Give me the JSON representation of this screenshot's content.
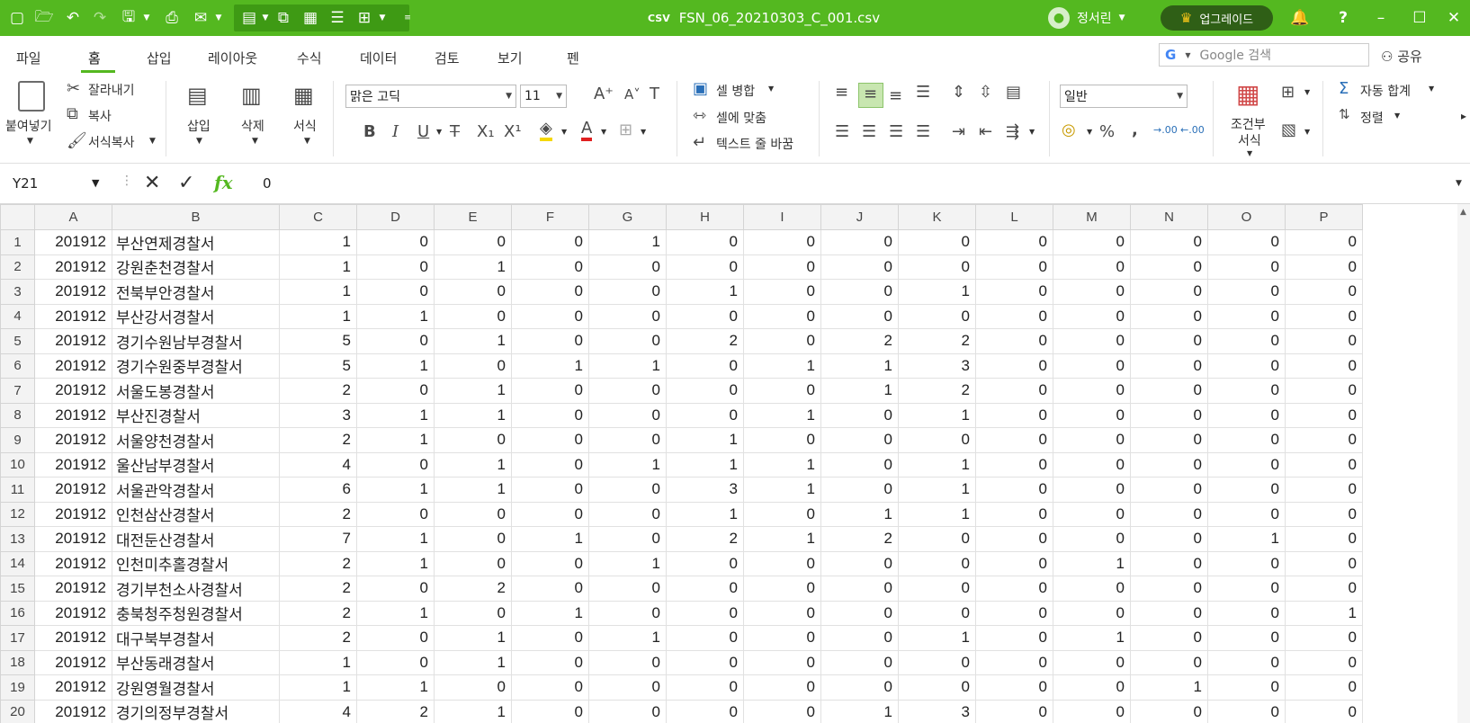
{
  "titlebar": {
    "file_badge": "CSV",
    "filename": "FSN_06_20210303_C_001.csv",
    "user_name": "정서린",
    "upgrade_label": "업그레이드",
    "icons": [
      "new-doc-icon",
      "open-folder-icon",
      "undo-icon",
      "redo-icon",
      "save-icon",
      "print-icon",
      "mail-icon",
      "paste-special-icon",
      "copy-format-icon",
      "form-icon",
      "list-icon",
      "table-icon",
      "more-icon",
      "bell-icon",
      "help-icon",
      "minimize-icon",
      "maximize-icon",
      "close-icon"
    ]
  },
  "menu": {
    "tabs": [
      "파일",
      "홈",
      "삽입",
      "레이아웃",
      "수식",
      "데이터",
      "검토",
      "보기",
      "펜"
    ],
    "active_tab": "홈",
    "search_placeholder": "Google 검색",
    "share_label": "공유"
  },
  "ribbon": {
    "paste": "붙여넣기",
    "cut": "잘라내기",
    "copy": "복사",
    "format_painter": "서식복사",
    "insert": "삽입",
    "delete": "삭제",
    "format": "서식",
    "font_name": "맑은 고딕",
    "font_size": "11",
    "merge": "셀 병합",
    "fit": "셀에 맞춤",
    "wrap": "텍스트 줄 바꿈",
    "number_format": "일반",
    "percent": "%",
    "comma": ",",
    "cond_format_1": "조건부",
    "cond_format_2": "서식",
    "autosum": "자동 합계",
    "sort": "정렬"
  },
  "formula": {
    "cell_ref": "Y21",
    "value": "0",
    "fx": "fx"
  },
  "sheet": {
    "columns": [
      "A",
      "B",
      "C",
      "D",
      "E",
      "F",
      "G",
      "H",
      "I",
      "J",
      "K",
      "L",
      "M",
      "N",
      "O",
      "P"
    ],
    "rows": [
      [
        "201912",
        "부산연제경찰서",
        "1",
        "0",
        "0",
        "0",
        "1",
        "0",
        "0",
        "0",
        "0",
        "0",
        "0",
        "0",
        "0",
        "0"
      ],
      [
        "201912",
        "강원춘천경찰서",
        "1",
        "0",
        "1",
        "0",
        "0",
        "0",
        "0",
        "0",
        "0",
        "0",
        "0",
        "0",
        "0",
        "0"
      ],
      [
        "201912",
        "전북부안경찰서",
        "1",
        "0",
        "0",
        "0",
        "0",
        "1",
        "0",
        "0",
        "1",
        "0",
        "0",
        "0",
        "0",
        "0"
      ],
      [
        "201912",
        "부산강서경찰서",
        "1",
        "1",
        "0",
        "0",
        "0",
        "0",
        "0",
        "0",
        "0",
        "0",
        "0",
        "0",
        "0",
        "0"
      ],
      [
        "201912",
        "경기수원남부경찰서",
        "5",
        "0",
        "1",
        "0",
        "0",
        "2",
        "0",
        "2",
        "2",
        "0",
        "0",
        "0",
        "0",
        "0"
      ],
      [
        "201912",
        "경기수원중부경찰서",
        "5",
        "1",
        "0",
        "1",
        "1",
        "0",
        "1",
        "1",
        "3",
        "0",
        "0",
        "0",
        "0",
        "0"
      ],
      [
        "201912",
        "서울도봉경찰서",
        "2",
        "0",
        "1",
        "0",
        "0",
        "0",
        "0",
        "1",
        "2",
        "0",
        "0",
        "0",
        "0",
        "0"
      ],
      [
        "201912",
        "부산진경찰서",
        "3",
        "1",
        "1",
        "0",
        "0",
        "0",
        "1",
        "0",
        "1",
        "0",
        "0",
        "0",
        "0",
        "0"
      ],
      [
        "201912",
        "서울양천경찰서",
        "2",
        "1",
        "0",
        "0",
        "0",
        "1",
        "0",
        "0",
        "0",
        "0",
        "0",
        "0",
        "0",
        "0"
      ],
      [
        "201912",
        "울산남부경찰서",
        "4",
        "0",
        "1",
        "0",
        "1",
        "1",
        "1",
        "0",
        "1",
        "0",
        "0",
        "0",
        "0",
        "0"
      ],
      [
        "201912",
        "서울관악경찰서",
        "6",
        "1",
        "1",
        "0",
        "0",
        "3",
        "1",
        "0",
        "1",
        "0",
        "0",
        "0",
        "0",
        "0"
      ],
      [
        "201912",
        "인천삼산경찰서",
        "2",
        "0",
        "0",
        "0",
        "0",
        "1",
        "0",
        "1",
        "1",
        "0",
        "0",
        "0",
        "0",
        "0"
      ],
      [
        "201912",
        "대전둔산경찰서",
        "7",
        "1",
        "0",
        "1",
        "0",
        "2",
        "1",
        "2",
        "0",
        "0",
        "0",
        "0",
        "1",
        "0"
      ],
      [
        "201912",
        "인천미추홀경찰서",
        "2",
        "1",
        "0",
        "0",
        "1",
        "0",
        "0",
        "0",
        "0",
        "0",
        "1",
        "0",
        "0",
        "0"
      ],
      [
        "201912",
        "경기부천소사경찰서",
        "2",
        "0",
        "2",
        "0",
        "0",
        "0",
        "0",
        "0",
        "0",
        "0",
        "0",
        "0",
        "0",
        "0"
      ],
      [
        "201912",
        "충북청주청원경찰서",
        "2",
        "1",
        "0",
        "1",
        "0",
        "0",
        "0",
        "0",
        "0",
        "0",
        "0",
        "0",
        "0",
        "1"
      ],
      [
        "201912",
        "대구북부경찰서",
        "2",
        "0",
        "1",
        "0",
        "1",
        "0",
        "0",
        "0",
        "1",
        "0",
        "1",
        "0",
        "0",
        "0"
      ],
      [
        "201912",
        "부산동래경찰서",
        "1",
        "0",
        "1",
        "0",
        "0",
        "0",
        "0",
        "0",
        "0",
        "0",
        "0",
        "0",
        "0",
        "0"
      ],
      [
        "201912",
        "강원영월경찰서",
        "1",
        "1",
        "0",
        "0",
        "0",
        "0",
        "0",
        "0",
        "0",
        "0",
        "0",
        "1",
        "0",
        "0"
      ],
      [
        "201912",
        "경기의정부경찰서",
        "4",
        "2",
        "1",
        "0",
        "0",
        "0",
        "0",
        "1",
        "3",
        "0",
        "0",
        "0",
        "0",
        "0"
      ]
    ]
  },
  "colors": {
    "accent": "#54b820",
    "accent_dark": "#2f5f16",
    "header_bg": "#f3f3f3"
  }
}
